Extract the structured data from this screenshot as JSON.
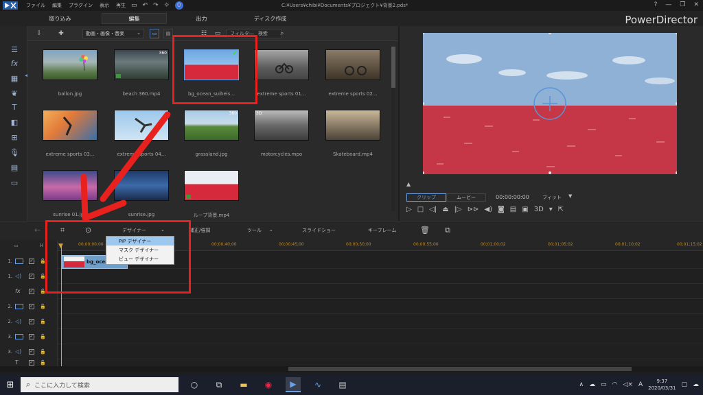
{
  "titlebar": {
    "menus": [
      "ファイル",
      "編集",
      "プラグイン",
      "表示",
      "再生"
    ],
    "path": "C:¥Users¥chibi¥Documents¥プロジェクト¥背景2.pds*",
    "user_badge": "0",
    "help": "?",
    "minimize": "—",
    "restore": "❐",
    "close": "✕"
  },
  "modes": {
    "capture": "取り込み",
    "edit": "編集",
    "output": "出力",
    "disc": "ディスク作成"
  },
  "brand": "PowerDirector",
  "library": {
    "dropdown_value": "動画・画像・音楽",
    "filter_placeholder": "フィルタ―",
    "search_label": "検索",
    "items": [
      {
        "name": "ballon.jpg"
      },
      {
        "name": "beach 360.mp4",
        "badge": "360"
      },
      {
        "name": "bg_ocean_suiheis...",
        "selected": true
      },
      {
        "name": "extreme sports 01..."
      },
      {
        "name": "extreme sports 02..."
      },
      {
        "name": "extreme sports 03..."
      },
      {
        "name": "extreme sports 04..."
      },
      {
        "name": "grassland.jpg",
        "badge": "360"
      },
      {
        "name": "motorcycles.mpo",
        "badge3d": "3D"
      },
      {
        "name": "Skateboard.mp4"
      },
      {
        "name": "sunrise 01.jpg"
      },
      {
        "name": "sunrise.jpg"
      },
      {
        "name": "ループ背景.mp4"
      }
    ]
  },
  "preview": {
    "tab_clip": "クリップ",
    "tab_movie": "ムービー",
    "timecode": "00:00:00:00",
    "fit": "フィット",
    "mode_3d": "3D"
  },
  "timeline_toolbar": {
    "designer": "デザイナー",
    "fix": "補正/強調",
    "tools": "ツール",
    "slideshow": "スライドショー",
    "keyframe": "キーフレーム"
  },
  "ruler": [
    "00;00;00;00",
    "00;00;40;00",
    "00;00;45;00",
    "00;00;50;00",
    "00;00;55;00",
    "00;01;00;02",
    "00;01;05;02",
    "00;01;10;02",
    "00;01;15;02"
  ],
  "tracks": [
    {
      "num": "1.",
      "kind": "video"
    },
    {
      "num": "1.",
      "kind": "audio"
    },
    {
      "num": "",
      "kind": "fx"
    },
    {
      "num": "2.",
      "kind": "video"
    },
    {
      "num": "2.",
      "kind": "audio"
    },
    {
      "num": "3.",
      "kind": "video"
    },
    {
      "num": "3.",
      "kind": "audio"
    },
    {
      "num": "",
      "kind": "title"
    }
  ],
  "clip": {
    "label": "bg_ocean_s"
  },
  "designer_menu": [
    "PiP デザイナー",
    "マスク デザイナー",
    "ビュー デザイナー"
  ],
  "taskbar": {
    "search_placeholder": "ここに入力して検索",
    "time": "9:37",
    "date": "2020/03/31",
    "ime": "A"
  },
  "colors": {
    "accent": "#6aa0e6",
    "annotation_red": "#e8211f",
    "sky": "#8fb1d6",
    "sea": "#c53747"
  }
}
